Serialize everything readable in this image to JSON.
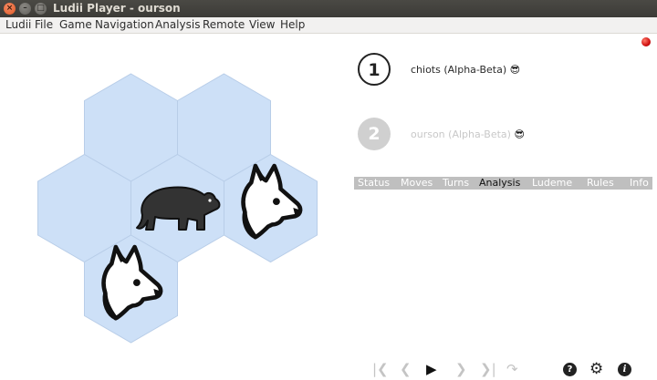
{
  "window": {
    "title": "Ludii Player - ourson"
  },
  "menu": [
    "Ludii",
    "File",
    "Game",
    "Navigation",
    "Analysis",
    "Remote",
    "View",
    "Help"
  ],
  "players": [
    {
      "number": "1",
      "name": "chiots (Alpha-Beta)",
      "active": true
    },
    {
      "number": "2",
      "name": "ourson (Alpha-Beta)",
      "active": false
    }
  ],
  "tabs": [
    {
      "label": "Status",
      "active": false
    },
    {
      "label": "Moves",
      "active": false
    },
    {
      "label": "Turns",
      "active": false
    },
    {
      "label": "Analysis",
      "active": true
    },
    {
      "label": "Ludeme",
      "active": false
    },
    {
      "label": "Rules",
      "active": false
    },
    {
      "label": "Info",
      "active": false
    }
  ],
  "board": {
    "cell_color": "#cde0f7",
    "pieces": [
      {
        "type": "bear",
        "cell": "center"
      },
      {
        "type": "dog",
        "cell": "right"
      },
      {
        "type": "dog",
        "cell": "bottom"
      }
    ]
  },
  "playback": [
    "skip-to-start-icon",
    "step-back-icon",
    "play-icon",
    "step-forward-icon",
    "skip-to-end-icon",
    "redo-arrow-icon"
  ],
  "colors": {
    "status_dot": "#d01010",
    "tab_bar": "#bfbfbf"
  }
}
